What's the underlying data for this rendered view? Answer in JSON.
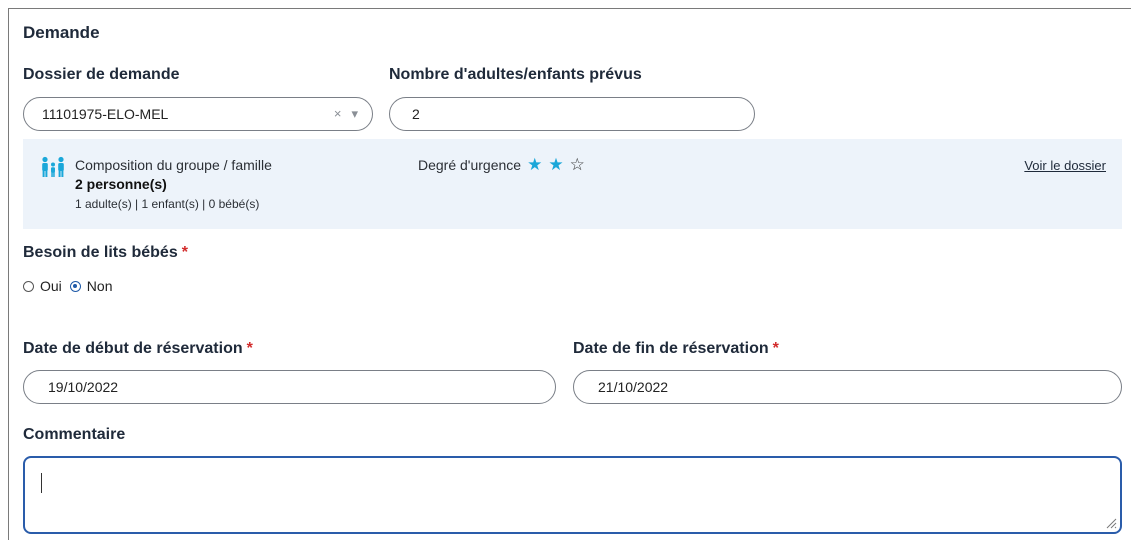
{
  "section": {
    "title": "Demande"
  },
  "dossier": {
    "label": "Dossier de demande",
    "value": "11101975-ELO-MEL",
    "clear_glyph": "×",
    "dropdown_glyph": "▾"
  },
  "nombre": {
    "label": "Nombre d'adultes/enfants prévus",
    "value": "2"
  },
  "info": {
    "icon": "family-icon",
    "composition_label": "Composition du groupe / famille",
    "composition_count": "2 personne(s)",
    "composition_detail": "1 adulte(s) | 1 enfant(s) | 0 bébé(s)",
    "urgence_label": "Degré d'urgence",
    "urgence_stars": 2,
    "urgence_max": 3,
    "star_color": "#1aa7d9",
    "voir_link": "Voir le dossier"
  },
  "lits": {
    "label": "Besoin de lits bébés",
    "required_mark": "*",
    "options": [
      "Oui",
      "Non"
    ],
    "selected": "Non"
  },
  "date_debut": {
    "label": "Date de début de réservation",
    "required_mark": "*",
    "value": "19/10/2022"
  },
  "date_fin": {
    "label": "Date de fin de réservation",
    "required_mark": "*",
    "value": "21/10/2022"
  },
  "commentaire": {
    "label": "Commentaire",
    "value": ""
  },
  "colors": {
    "focus_border": "#2a5caa",
    "required": "#d22b2b",
    "info_bg": "#edf3fa"
  }
}
